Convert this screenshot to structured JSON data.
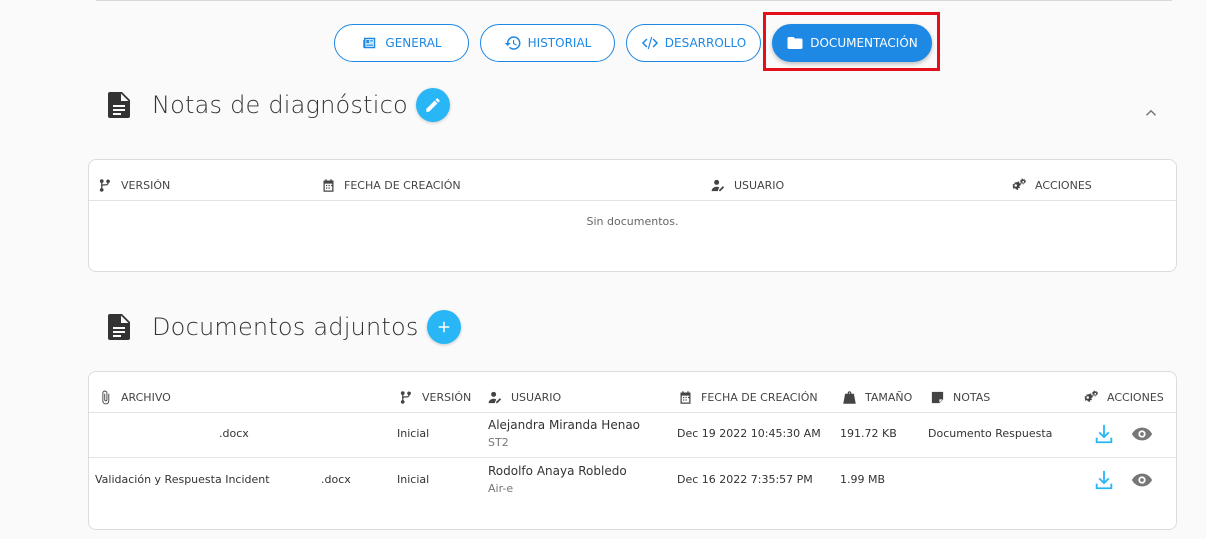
{
  "tabs": [
    {
      "label": "GENERAL",
      "icon": "newspaper-icon"
    },
    {
      "label": "HISTORIAL",
      "icon": "history-icon"
    },
    {
      "label": "DESARROLLO",
      "icon": "code-icon"
    },
    {
      "label": "DOCUMENTACIÓN",
      "icon": "folder-icon",
      "active": true
    }
  ],
  "notas": {
    "title": "Notas de diagnóstico",
    "columns": {
      "version": "VERSIÓN",
      "fecha": "FECHA DE CREACIÓN",
      "usuario": "USUARIO",
      "acciones": "ACCIONES"
    },
    "empty_text": "Sin documentos."
  },
  "adjuntos": {
    "title": "Documentos adjuntos",
    "columns": {
      "archivo": "ARCHIVO",
      "version": "VERSIÓN",
      "usuario": "USUARIO",
      "fecha": "FECHA DE CREACIÓN",
      "tamano": "TAMAÑO",
      "notas": "NOTAS",
      "acciones": "ACCIONES"
    },
    "rows": [
      {
        "archivo_name": "",
        "archivo_ext": ".docx",
        "version": "Inicial",
        "usuario": "Alejandra Miranda Henao",
        "usuario_sub": "ST2",
        "fecha": "Dec 19 2022 10:45:30 AM",
        "tamano": "191.72 KB",
        "notas": "Documento Respuesta"
      },
      {
        "archivo_name": "Validación y Respuesta Incidente",
        "archivo_ext": ".docx",
        "version": "Inicial",
        "usuario": "Rodolfo Anaya Robledo",
        "usuario_sub": "Air-e",
        "fecha": "Dec 16 2022 7:35:57 PM",
        "tamano": "1.99 MB",
        "notas": ""
      }
    ]
  },
  "colors": {
    "accent": "#1e88e5",
    "fab": "#29b6f6",
    "highlight": "#e3101c"
  }
}
